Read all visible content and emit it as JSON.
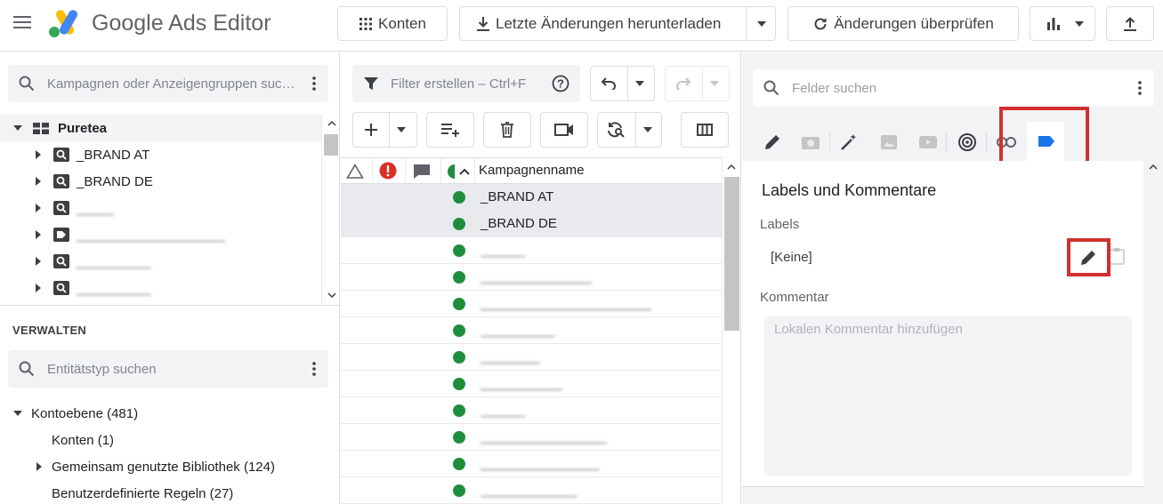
{
  "app": {
    "title": "Google Ads Editor"
  },
  "toolbar": {
    "accounts_label": "Konten",
    "download_label": "Letzte Änderungen herunterladen",
    "review_label": "Änderungen überprüfen"
  },
  "left": {
    "search_placeholder": "Kampagnen oder Anzeigengruppen suc…",
    "account_name": "Puretea",
    "campaigns": [
      {
        "label": "_BRAND AT",
        "blurred": false
      },
      {
        "label": "_BRAND DE",
        "blurred": false
      },
      {
        "label": "_____",
        "blurred": true
      },
      {
        "label": "____________________",
        "blurred": true
      },
      {
        "label": "__________",
        "blurred": true
      },
      {
        "label": "__________",
        "blurred": true
      }
    ],
    "manage_heading": "VERWALTEN",
    "entity_search_placeholder": "Entitätstyp suchen",
    "manage_items": [
      {
        "label": "Kontoebene (481)"
      },
      {
        "label": "Konten (1)"
      },
      {
        "label": "Gemeinsam genutzte Bibliothek (124)"
      },
      {
        "label": "Benutzerdefinierte Regeln (27)"
      }
    ]
  },
  "middle": {
    "filter_placeholder": "Filter erstellen – Ctrl+F",
    "column_header": "Kampagnenname",
    "rows": [
      {
        "name": "_BRAND AT",
        "selected": true,
        "blurred": false
      },
      {
        "name": "_BRAND DE",
        "selected": true,
        "blurred": false
      },
      {
        "name": "______",
        "selected": false,
        "blurred": true
      },
      {
        "name": "_______________",
        "selected": false,
        "blurred": true
      },
      {
        "name": "_______________________",
        "selected": false,
        "blurred": true
      },
      {
        "name": "__________",
        "selected": false,
        "blurred": true
      },
      {
        "name": "________",
        "selected": false,
        "blurred": true
      },
      {
        "name": "___________",
        "selected": false,
        "blurred": true
      },
      {
        "name": "______",
        "selected": false,
        "blurred": true
      },
      {
        "name": "_________________",
        "selected": false,
        "blurred": true
      },
      {
        "name": "________________",
        "selected": false,
        "blurred": true
      },
      {
        "name": "_____________",
        "selected": false,
        "blurred": true
      }
    ]
  },
  "right": {
    "search_placeholder": "Felder suchen",
    "section_title": "Labels und Kommentare",
    "labels_heading": "Labels",
    "labels_value": "[Keine]",
    "comment_heading": "Kommentar",
    "comment_placeholder": "Lokalen Kommentar hinzufügen"
  },
  "colors": {
    "accent": "#1a73e8",
    "status_green": "#1e8e3e",
    "highlight_red": "#d32f2f",
    "error_red": "#d93025"
  }
}
